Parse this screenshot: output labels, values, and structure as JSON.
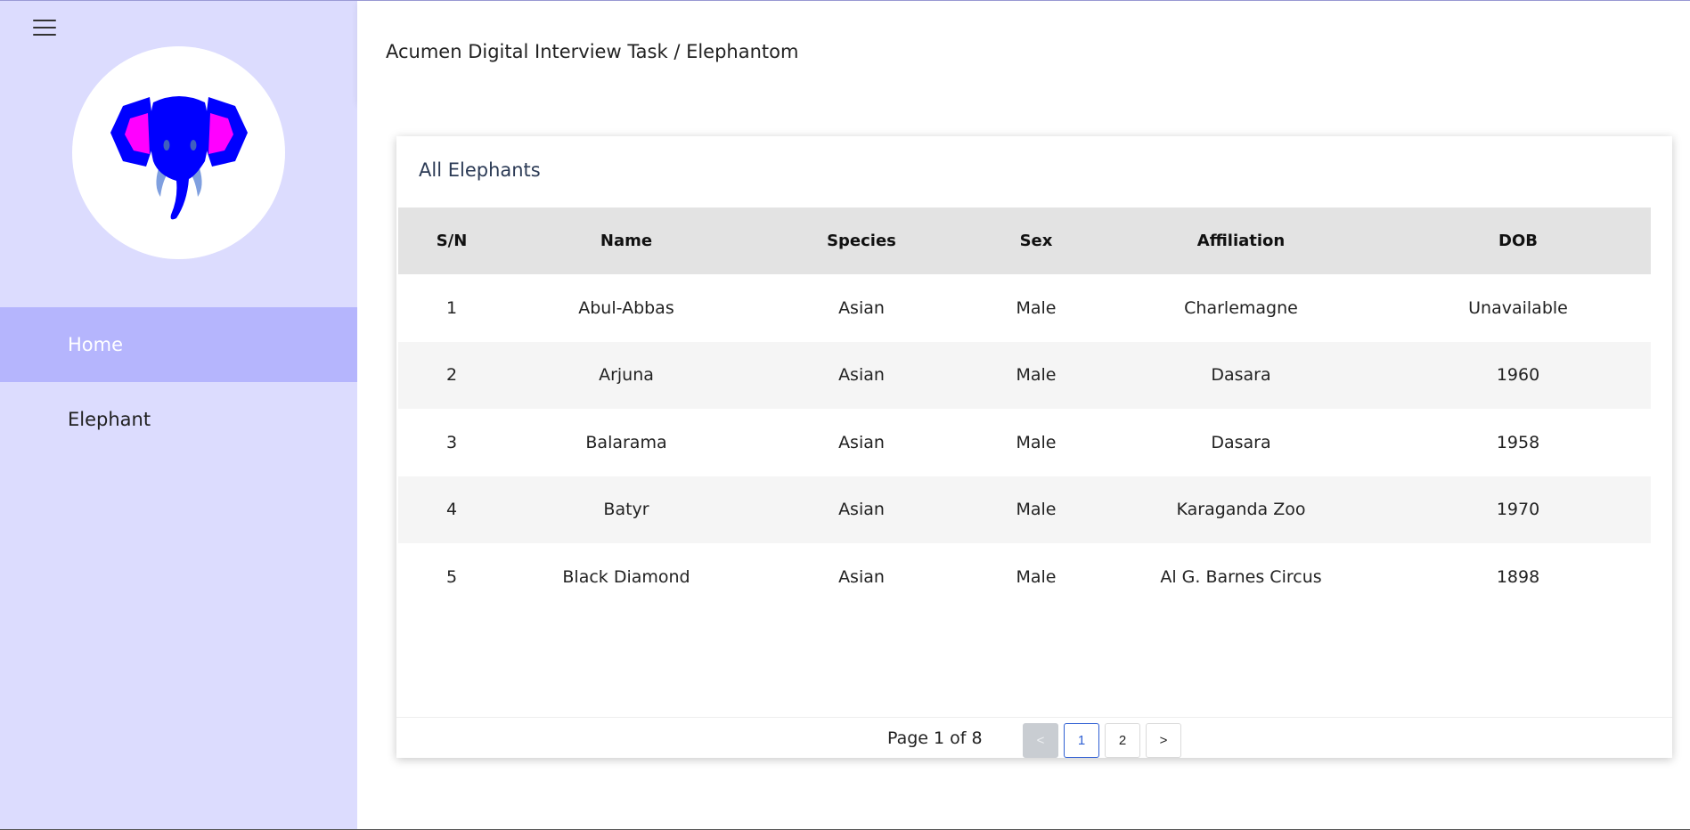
{
  "header": {
    "breadcrumb": "Acumen Digital Interview Task / Elephantom"
  },
  "sidebar": {
    "items": [
      {
        "label": "Home",
        "active": true
      },
      {
        "label": "Elephant",
        "active": false
      }
    ]
  },
  "card": {
    "title": "All Elephants",
    "columns": [
      "S/N",
      "Name",
      "Species",
      "Sex",
      "Affiliation",
      "DOB"
    ],
    "rows": [
      [
        "1",
        "Abul-Abbas",
        "Asian",
        "Male",
        "Charlemagne",
        "Unavailable"
      ],
      [
        "2",
        "Arjuna",
        "Asian",
        "Male",
        "Dasara",
        "1960"
      ],
      [
        "3",
        "Balarama",
        "Asian",
        "Male",
        "Dasara",
        "1958"
      ],
      [
        "4",
        "Batyr",
        "Asian",
        "Male",
        "Karaganda Zoo",
        "1970"
      ],
      [
        "5",
        "Black Diamond",
        "Asian",
        "Male",
        "Al G. Barnes Circus",
        "1898"
      ]
    ]
  },
  "pagination": {
    "info": "Page 1 of 8",
    "prev": "<",
    "pages": [
      "1",
      "2"
    ],
    "next": ">"
  },
  "colors": {
    "sidebar_bg": "#dcdcfe",
    "active_item_bg": "#b5b5fd",
    "logo_head": "#0000ff",
    "logo_ear": "#ff00ff",
    "logo_tusk": "#7f9fdf"
  },
  "icons": [
    "hamburger-menu-icon",
    "elephant-logo"
  ]
}
